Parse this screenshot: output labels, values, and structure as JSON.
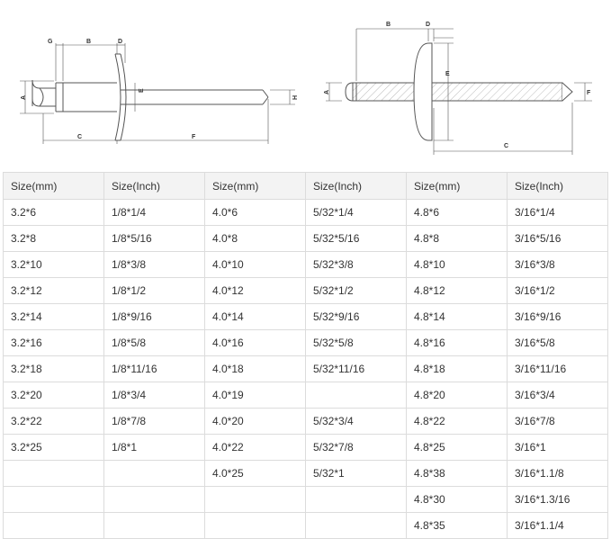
{
  "diagram_labels": {
    "left": [
      "G",
      "B",
      "D",
      "A",
      "E",
      "H",
      "C",
      "F"
    ],
    "right": [
      "B",
      "D",
      "A",
      "E",
      "F",
      "C"
    ]
  },
  "table": {
    "headers": [
      "Size(mm)",
      "Size(Inch)",
      "Size(mm)",
      "Size(Inch)",
      "Size(mm)",
      "Size(Inch)"
    ],
    "rows": [
      [
        "3.2*6",
        "1/8*1/4",
        "4.0*6",
        "5/32*1/4",
        "4.8*6",
        "3/16*1/4"
      ],
      [
        "3.2*8",
        "1/8*5/16",
        "4.0*8",
        "5/32*5/16",
        "4.8*8",
        "3/16*5/16"
      ],
      [
        "3.2*10",
        "1/8*3/8",
        "4.0*10",
        "5/32*3/8",
        "4.8*10",
        "3/16*3/8"
      ],
      [
        "3.2*12",
        "1/8*1/2",
        "4.0*12",
        "5/32*1/2",
        "4.8*12",
        "3/16*1/2"
      ],
      [
        "3.2*14",
        "1/8*9/16",
        "4.0*14",
        "5/32*9/16",
        "4.8*14",
        "3/16*9/16"
      ],
      [
        "3.2*16",
        "1/8*5/8",
        "4.0*16",
        "5/32*5/8",
        "4.8*16",
        "3/16*5/8"
      ],
      [
        "3.2*18",
        "1/8*11/16",
        "4.0*18",
        "5/32*11/16",
        "4.8*18",
        "3/16*11/16"
      ],
      [
        "3.2*20",
        "1/8*3/4",
        "4.0*19",
        "",
        "4.8*20",
        "3/16*3/4"
      ],
      [
        "3.2*22",
        "1/8*7/8",
        "4.0*20",
        "5/32*3/4",
        "4.8*22",
        "3/16*7/8"
      ],
      [
        "3.2*25",
        "1/8*1",
        "4.0*22",
        "5/32*7/8",
        "4.8*25",
        "3/16*1"
      ],
      [
        "",
        "",
        "4.0*25",
        "5/32*1",
        "4.8*38",
        "3/16*1.1/8"
      ],
      [
        "",
        "",
        "",
        "",
        "4.8*30",
        "3/16*1.3/16"
      ],
      [
        "",
        "",
        "",
        "",
        "4.8*35",
        "3/16*1.1/4"
      ]
    ]
  }
}
